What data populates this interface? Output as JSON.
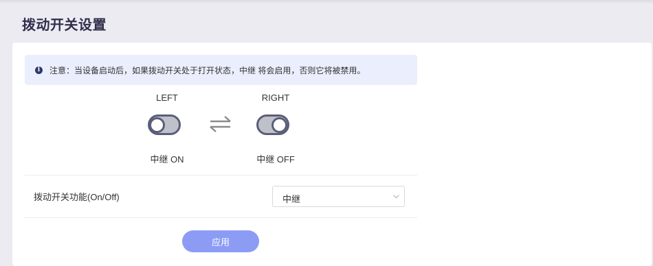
{
  "page": {
    "title": "拨动开关设置"
  },
  "notice": {
    "icon": "info-icon",
    "text": "注意：当设备启动后，如果拨动开关处于打开状态，中继 将会启用，否则它将被禁用。"
  },
  "switches": {
    "left": {
      "position_label": "LEFT",
      "state_label": "中继 ON",
      "knob": "left"
    },
    "right": {
      "position_label": "RIGHT",
      "state_label": "中继 OFF",
      "knob": "right"
    },
    "swap_icon": "swap-arrows-icon"
  },
  "function": {
    "label": "拨动开关功能(On/Off)",
    "selected": "中继"
  },
  "actions": {
    "apply_label": "应用"
  },
  "colors": {
    "accent_button": "#8c9cf5",
    "notice_bg": "#ebeefc",
    "toggle_outline": "#5a5e78",
    "toggle_fill": "#bfc1ca"
  }
}
